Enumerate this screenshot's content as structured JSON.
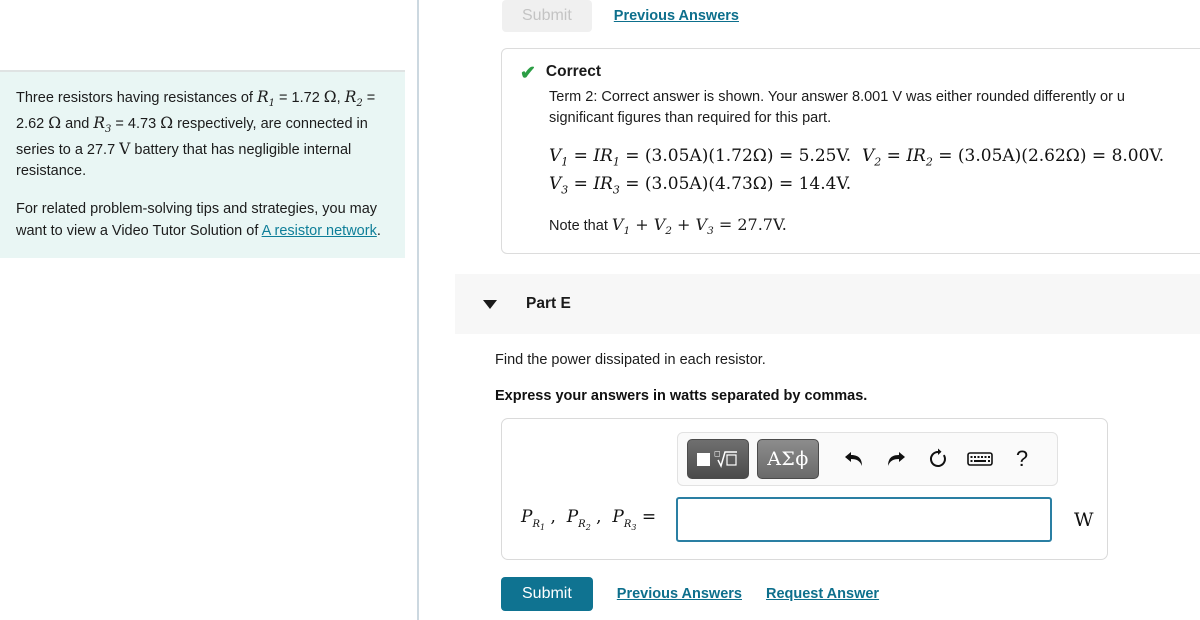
{
  "problem": {
    "statement_line1_a": "Three resistors having resistances of ",
    "r1_symbol": "R",
    "r1_sub": "1",
    "r1_value": " = 1.72 ",
    "ohm": "Ω",
    "statement_line2_a": ", ",
    "r2_symbol": "R",
    "r2_sub": "2",
    "r2_value": " = 2.62 ",
    "and_word": " and ",
    "r3_symbol": "R",
    "r3_sub": "3",
    "r3_value": " = 4.73 ",
    "statement_tail": " respectively, are connected in series to a 27.7 ",
    "volt_symbol": "V",
    "statement_tail2": " battery that has negligible internal resistance.",
    "tips_text": "For related problem-solving tips and strategies, you may want to view a Video Tutor Solution of ",
    "tutor_link": "A resistor network",
    "tips_period": "."
  },
  "top_actions": {
    "submit_label": "Submit",
    "previous_answers_label": "Previous Answers"
  },
  "feedback": {
    "status_icon": "check-icon",
    "status_label": "Correct",
    "note_line1": "Term 2: Correct answer is shown. Your answer 8.001 V was either rounded differently or u",
    "note_line2": "significant figures than required for this part.",
    "note_value": "8.001",
    "note_unit": "V",
    "equation_line1": "V₁ = IR₁ = (3.05A)(1.72Ω) = 5.25V.  V₂ = IR₂ = (3.05A)(2.62Ω) = 8.00V.",
    "equation_line2": "V₃ = IR₃ = (3.05A)(4.73Ω) = 14.4V.",
    "eq": {
      "current": "3.05A",
      "r1": "1.72Ω",
      "v1": "5.25V",
      "r2": "2.62Ω",
      "v2": "8.00V",
      "r3": "4.73Ω",
      "v3": "14.4V",
      "sum": "27.7V"
    },
    "note_prefix": "Note that ",
    "note_sum_text": "V₁ + V₂ + V₃ = 27.7V."
  },
  "part": {
    "caret_icon": "chevron-down-icon",
    "title": "Part E",
    "prompt": "Find the power dissipated in each resistor.",
    "instruction": "Express your answers in watts separated by commas."
  },
  "answer": {
    "toolbar": {
      "template_button": "template-sqrt-button",
      "greek_button": "ΑΣϕ",
      "undo_icon": "undo-arrow-icon",
      "redo_icon": "redo-arrow-icon",
      "reset_icon": "reset-circle-icon",
      "keyboard_icon": "keyboard-icon",
      "help_icon": "?"
    },
    "label_p": "P",
    "label_full": "P_R1 , P_R2 , P_R3 =",
    "equals": "=",
    "comma": ",",
    "input_value": "",
    "input_placeholder": "",
    "unit": "W"
  },
  "bottom_actions": {
    "submit_label": "Submit",
    "previous_answers_label": "Previous Answers",
    "request_answer_label": "Request Answer"
  },
  "colors": {
    "accent_teal": "#0f7391",
    "link_teal": "#0d6f8c",
    "problem_panel_bg": "#e9f6f4",
    "correct_green": "#2c9e45",
    "input_border": "#2a7fa3",
    "part_header_bg": "#f7f7f7"
  }
}
